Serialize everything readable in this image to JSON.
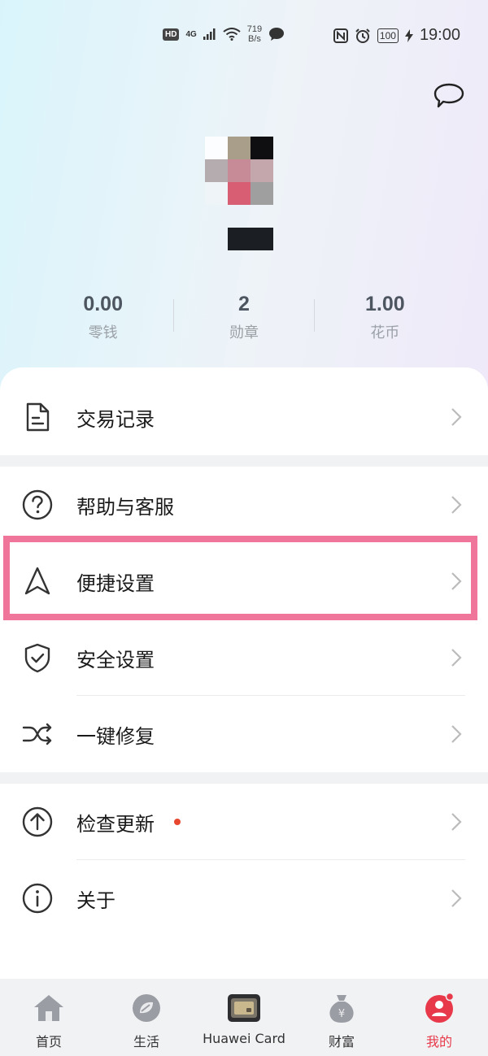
{
  "status_bar": {
    "hd": "HD",
    "network": "4G",
    "speed_value": "719",
    "speed_unit": "B/s",
    "battery": "100",
    "time": "19:00"
  },
  "stats": [
    {
      "value": "0.00",
      "label": "零钱"
    },
    {
      "value": "2",
      "label": "勋章"
    },
    {
      "value": "1.00",
      "label": "花币"
    }
  ],
  "menu": {
    "transactions": "交易记录",
    "help": "帮助与客服",
    "quick_settings": "便捷设置",
    "security": "安全设置",
    "repair": "一键修复",
    "update": "检查更新",
    "about": "关于"
  },
  "nav": [
    {
      "label": "首页",
      "icon": "home-icon"
    },
    {
      "label": "生活",
      "icon": "life-icon"
    },
    {
      "label": "Huawei Card",
      "icon": "card-icon"
    },
    {
      "label": "财富",
      "icon": "money-bag-icon"
    },
    {
      "label": "我的",
      "icon": "profile-icon"
    }
  ],
  "colors": {
    "accent": "#e8394a",
    "highlight_border": "#f0759a",
    "notice_dot": "#e8472f"
  }
}
